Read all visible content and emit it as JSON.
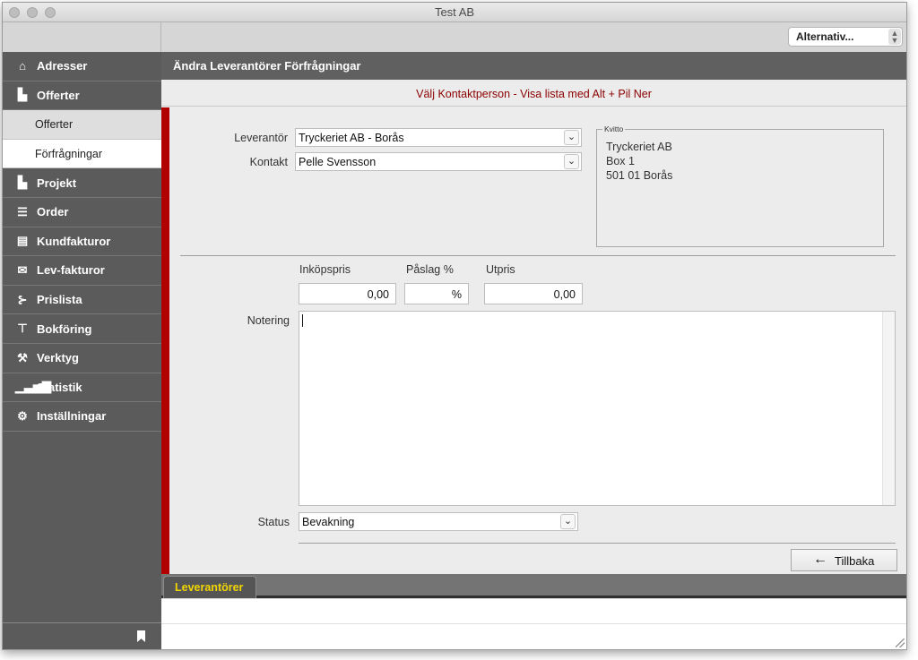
{
  "window": {
    "title": "Test AB"
  },
  "toolbar": {
    "options_label": "Alternativ..."
  },
  "sidebar": {
    "items": [
      {
        "label": "Adresser",
        "icon": "home-icon"
      },
      {
        "label": "Offerter",
        "icon": "document-icon"
      },
      {
        "label": "Projekt",
        "icon": "document-icon"
      },
      {
        "label": "Order",
        "icon": "list-icon"
      },
      {
        "label": "Kundfakturor",
        "icon": "invoice-icon"
      },
      {
        "label": "Lev-fakturor",
        "icon": "mail-icon"
      },
      {
        "label": "Prislista",
        "icon": "pricelist-icon"
      },
      {
        "label": "Bokföring",
        "icon": "ledger-icon"
      },
      {
        "label": "Verktyg",
        "icon": "wrench-icon"
      },
      {
        "label": "Statistik",
        "icon": "bar-chart-icon"
      },
      {
        "label": "Inställningar",
        "icon": "gear-icon"
      }
    ],
    "subitems": [
      {
        "label": "Offerter",
        "active": false
      },
      {
        "label": "Förfrågningar",
        "active": true
      }
    ]
  },
  "header": {
    "title": "Ändra Leverantörer Förfrågningar"
  },
  "hint": {
    "text": "Välj Kontaktperson - Visa lista med Alt + Pil Ner"
  },
  "form": {
    "supplier_label": "Leverantör",
    "supplier_value": "Tryckeriet AB  - Borås",
    "contact_label": "Kontakt",
    "contact_value": "Pelle Svensson",
    "kvitto_legend": "Kvitto",
    "kvitto_lines": [
      "Tryckeriet AB",
      "Box 1",
      "501 01   Borås"
    ],
    "purchase_price_label": "Inköpspris",
    "purchase_price_value": "0,00",
    "markup_label": "Påslag %",
    "markup_value": "%",
    "sale_price_label": "Utpris",
    "sale_price_value": "0,00",
    "notes_label": "Notering",
    "notes_value": "",
    "status_label": "Status",
    "status_value": "Bevakning",
    "back_button_label": "Tillbaka"
  },
  "tabs": [
    {
      "label": "Leverantörer"
    }
  ],
  "colors": {
    "accent_red": "#b00000",
    "tab_text": "#f1d600",
    "hint_text": "#8b0000",
    "sidebar_bg": "#5b5b5b"
  }
}
